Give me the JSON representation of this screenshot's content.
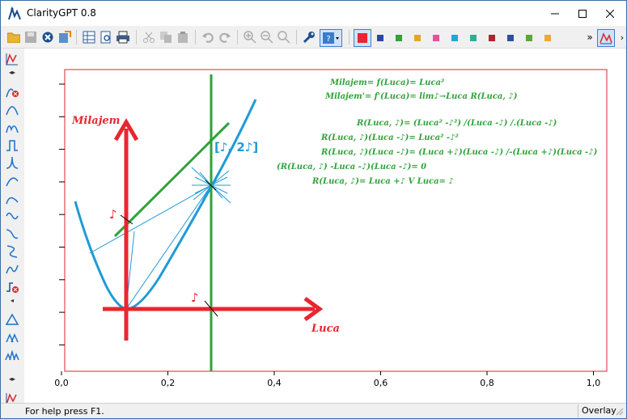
{
  "window": {
    "title": "ClarityGPT 0.8"
  },
  "toolbar": {
    "swatches": [
      "#e8262f",
      "#2a47a8",
      "#2ea33a",
      "#e3a91e",
      "#e84f9c",
      "#21a6d8",
      "#29b09a",
      "#b0232a",
      "#2f4f9a",
      "#5aa83a",
      "#f0a630"
    ],
    "more_label": "»"
  },
  "plot": {
    "x_ticks": [
      "0,0",
      "0,2",
      "0,4",
      "0,6",
      "0,8",
      "1,0"
    ],
    "x_axis_label": "Luca",
    "y_axis_label": "Milajem",
    "note_left": "♪",
    "note_bottom": "♪",
    "point_label": "[♪, 2♪]",
    "formulas": {
      "f1": "Milajem= f(Luca)= Luca²",
      "f2": "Milajem'= f'(Luca)= lim♪→Luca R(Luca, ♪)",
      "f3": "R(Luca, ♪)= (Luca² -♪²) /(Luca -♪) /.(Luca -♪)",
      "f4": "R(Luca, ♪)(Luca -♪)= Luca² -♪²",
      "f5": "R(Luca, ♪)(Luca -♪)= (Luca +♪)(Luca -♪)    /-(Luca +♪)(Luca -♪)",
      "f6": "(R(Luca, ♪) -Luca -♪)(Luca -♪)= 0",
      "f7": "R(Luca, ♪)= Luca +♪ V Luca= ♪"
    }
  },
  "status": {
    "help": "For help press F1.",
    "mode": "Overlay"
  }
}
